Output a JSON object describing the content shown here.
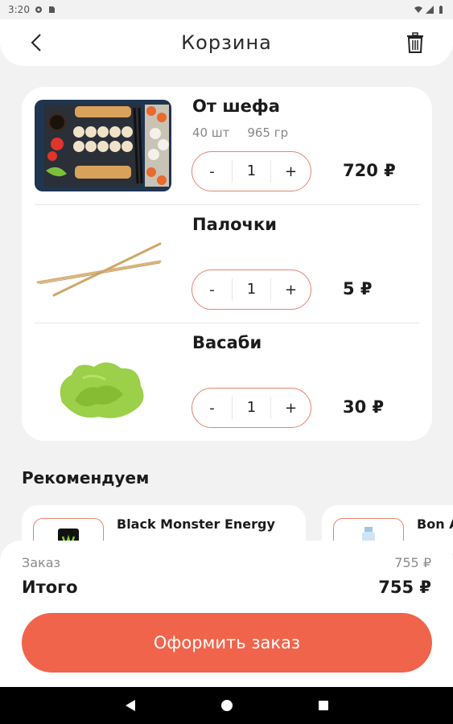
{
  "status_bar": {
    "time": "3:20"
  },
  "header": {
    "title": "Корзина"
  },
  "cart": {
    "items": [
      {
        "name": "От шефа",
        "pieces": "40 шт",
        "weight": "965 гр",
        "minus": "-",
        "qty": "1",
        "plus": "+",
        "price": "720 ₽",
        "image": "sushi-platter-image"
      },
      {
        "name": "Палочки",
        "pieces": "",
        "weight": "",
        "minus": "-",
        "qty": "1",
        "plus": "+",
        "price": "5 ₽",
        "image": "chopsticks-image"
      },
      {
        "name": "Васаби",
        "pieces": "",
        "weight": "",
        "minus": "-",
        "qty": "1",
        "plus": "+",
        "price": "30 ₽",
        "image": "wasabi-image"
      }
    ]
  },
  "recommended": {
    "title": "Рекомендуем",
    "items": [
      {
        "name": "Black Monster Energy",
        "image": "energy-drink-can-image"
      },
      {
        "name": "Bon A",
        "image": "water-bottle-image"
      }
    ]
  },
  "summary": {
    "order_label": "Заказ",
    "order_value": "755 ₽",
    "total_label": "Итого",
    "total_value": "755 ₽",
    "checkout_label": "Оформить заказ"
  },
  "colors": {
    "accent": "#f0644b",
    "stepper_border": "#e9836f",
    "background": "#f2f2f2"
  }
}
